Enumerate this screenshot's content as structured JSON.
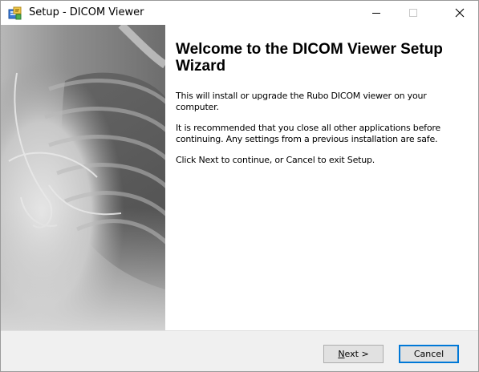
{
  "window": {
    "title": "Setup - DICOM Viewer",
    "accent_color": "#0078d7"
  },
  "caption_buttons": {
    "minimize_icon": "minimize-icon",
    "maximize_icon": "maximize-icon",
    "close_icon": "close-icon",
    "close_glyph": "✕"
  },
  "main": {
    "heading": "Welcome to the DICOM Viewer Setup Wizard",
    "paragraphs": [
      "This will install or upgrade the Rubo DICOM viewer on your computer.",
      "It is recommended that you close all other applications before continuing. Any settings from a previous installation are safe.",
      "Click Next to continue, or Cancel to exit Setup."
    ]
  },
  "buttons": {
    "next_mnemonic": "N",
    "next_rest": "ext >",
    "cancel": "Cancel"
  }
}
